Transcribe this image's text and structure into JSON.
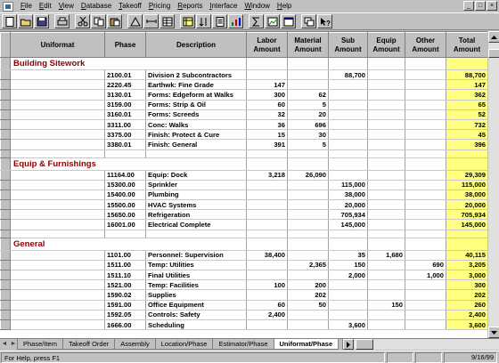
{
  "menu": [
    {
      "u": "F",
      "rest": "ile"
    },
    {
      "u": "E",
      "rest": "dit"
    },
    {
      "u": "V",
      "rest": "iew"
    },
    {
      "u": "D",
      "rest": "atabase"
    },
    {
      "u": "T",
      "rest": "akeoff"
    },
    {
      "u": "P",
      "rest": "ricing"
    },
    {
      "u": "R",
      "rest": "eports"
    },
    {
      "u": "I",
      "rest": "nterface"
    },
    {
      "u": "W",
      "rest": "indow"
    },
    {
      "u": "H",
      "rest": "elp"
    }
  ],
  "window_controls": [
    "_",
    "□",
    "×"
  ],
  "toolbar": [
    "new-icon",
    "open-icon",
    "save-icon",
    "print-icon",
    "cut-icon",
    "copy-icon",
    "paste-icon",
    "takeoff-icon",
    "scale-icon",
    "table-icon",
    "grid-icon",
    "sort-icon",
    "report-icon",
    "chart-icon",
    "sum-icon",
    "image-icon",
    "window-icon",
    "copy-window-icon",
    "help-icon"
  ],
  "columns": [
    "Uniformat",
    "Phase",
    "Description",
    "Labor Amount",
    "Material Amount",
    "Sub Amount",
    "Equip Amount",
    "Other Amount",
    "Total Amount"
  ],
  "groups": [
    {
      "name": "Building Sitework",
      "rows": [
        [
          "2100.01",
          "Division 2 Subcontractors",
          "",
          "",
          "88,700",
          "",
          "",
          "88,700"
        ],
        [
          "2220.45",
          "Earthwk: Fine Grade",
          "147",
          "",
          "",
          "",
          "",
          "147"
        ],
        [
          "3130.01",
          "Forms: Edgeform at Walks",
          "300",
          "62",
          "",
          "",
          "",
          "362"
        ],
        [
          "3159.00",
          "Forms: Strip & Oil",
          "60",
          "5",
          "",
          "",
          "",
          "65"
        ],
        [
          "3160.01",
          "Forms: Screeds",
          "32",
          "20",
          "",
          "",
          "",
          "52"
        ],
        [
          "3311.00",
          "Conc: Walks",
          "36",
          "696",
          "",
          "",
          "",
          "732"
        ],
        [
          "3375.00",
          "Finish: Protect & Cure",
          "15",
          "30",
          "",
          "",
          "",
          "45"
        ],
        [
          "3380.01",
          "Finish: General",
          "391",
          "5",
          "",
          "",
          "",
          "396"
        ]
      ]
    },
    {
      "name": "Equip & Furnishings",
      "rows": [
        [
          "11164.00",
          "Equip: Dock",
          "3,218",
          "26,090",
          "",
          "",
          "",
          "29,309"
        ],
        [
          "15300.00",
          "Sprinkler",
          "",
          "",
          "115,000",
          "",
          "",
          "115,000"
        ],
        [
          "15400.00",
          "Plumbing",
          "",
          "",
          "38,000",
          "",
          "",
          "38,000"
        ],
        [
          "15500.00",
          "HVAC Systems",
          "",
          "",
          "20,000",
          "",
          "",
          "20,000"
        ],
        [
          "15650.00",
          "Refrigeration",
          "",
          "",
          "705,934",
          "",
          "",
          "705,934"
        ],
        [
          "16001.00",
          "Electrical Complete",
          "",
          "",
          "145,000",
          "",
          "",
          "145,000"
        ]
      ]
    },
    {
      "name": "General",
      "rows": [
        [
          "1101.00",
          "Personnel: Supervision",
          "38,400",
          "",
          "35",
          "1,680",
          "",
          "40,115"
        ],
        [
          "1511.00",
          "Temp: Utilities",
          "",
          "2,365",
          "150",
          "",
          "690",
          "3,205"
        ],
        [
          "1511.10",
          "Final Utilities",
          "",
          "",
          "2,000",
          "",
          "1,000",
          "3,000"
        ],
        [
          "1521.00",
          "Temp: Facilities",
          "100",
          "200",
          "",
          "",
          "",
          "300"
        ],
        [
          "1590.02",
          "Supplies",
          "",
          "202",
          "",
          "",
          "",
          "202"
        ],
        [
          "1591.00",
          "Office Equipment",
          "60",
          "50",
          "",
          "150",
          "",
          "260"
        ],
        [
          "1592.05",
          "Controls: Safety",
          "2,400",
          "",
          "",
          "",
          "",
          "2,400"
        ],
        [
          "1666.00",
          "Scheduling",
          "",
          "",
          "3,600",
          "",
          "",
          "3,600"
        ]
      ]
    }
  ],
  "tabs": [
    {
      "label": "Phase/Item",
      "active": false
    },
    {
      "label": "Takeoff Order",
      "active": false
    },
    {
      "label": "Assembly",
      "active": false
    },
    {
      "label": "Location/Phase",
      "active": false
    },
    {
      "label": "Estimator/Phase",
      "active": false
    },
    {
      "label": "Uniformat/Phase",
      "active": true
    }
  ],
  "tab_nav": [
    "◄",
    "►"
  ],
  "status": {
    "text": "For Help, press F1",
    "date": "9/16/99"
  },
  "colors": {
    "group_name": "#8b0000",
    "total_bg": "#ffff80",
    "chrome": "#c0c0c0"
  }
}
